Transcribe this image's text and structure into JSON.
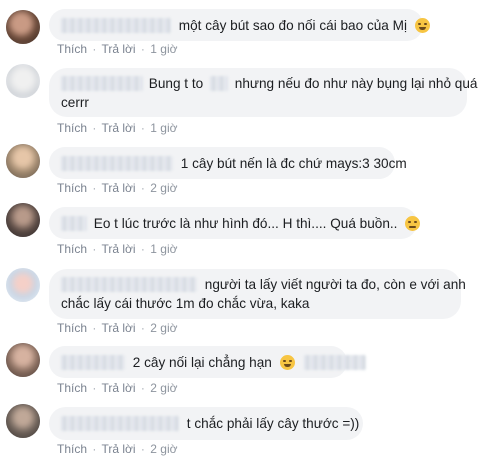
{
  "actions": {
    "like": "Thích",
    "reply": "Trả lời",
    "separator": "·"
  },
  "comments": [
    {
      "lines": [
        "một cây bút sao đo nối cái bao của Mị"
      ],
      "emoji": "rolling-on-floor-laughing-emoji",
      "time": "1 giờ"
    },
    {
      "lines": [
        "Bung t to",
        "nhưng nếu đo như này bụng lại nhỏ quá",
        "cerrr"
      ],
      "time": "1 giờ"
    },
    {
      "lines": [
        "1 cây bút nến là đc chứ mays:3 30cm"
      ],
      "time": "2 giờ"
    },
    {
      "lines": [
        "Eo t lúc trước là như hình đó... H thì.... Quá buồn.."
      ],
      "emoji": "pensive-face-emoji",
      "time": "1 giờ"
    },
    {
      "lines": [
        "người ta lấy viết người ta đo, còn e với anh",
        "chắc lấy cái thước 1m đo chắc vừa, kaka"
      ],
      "time": "2 giờ"
    },
    {
      "lines": [
        "2 cây nối lại chẳng hạn"
      ],
      "emoji": "grinning-squinting-face-emoji",
      "time": "2 giờ"
    },
    {
      "lines": [
        "t chắc phải lấy cây thước =))"
      ],
      "time": "2 giờ"
    }
  ],
  "colors": {
    "bubble": "#f2f3f5",
    "text": "#1c1e21",
    "meta": "#8d949e"
  }
}
